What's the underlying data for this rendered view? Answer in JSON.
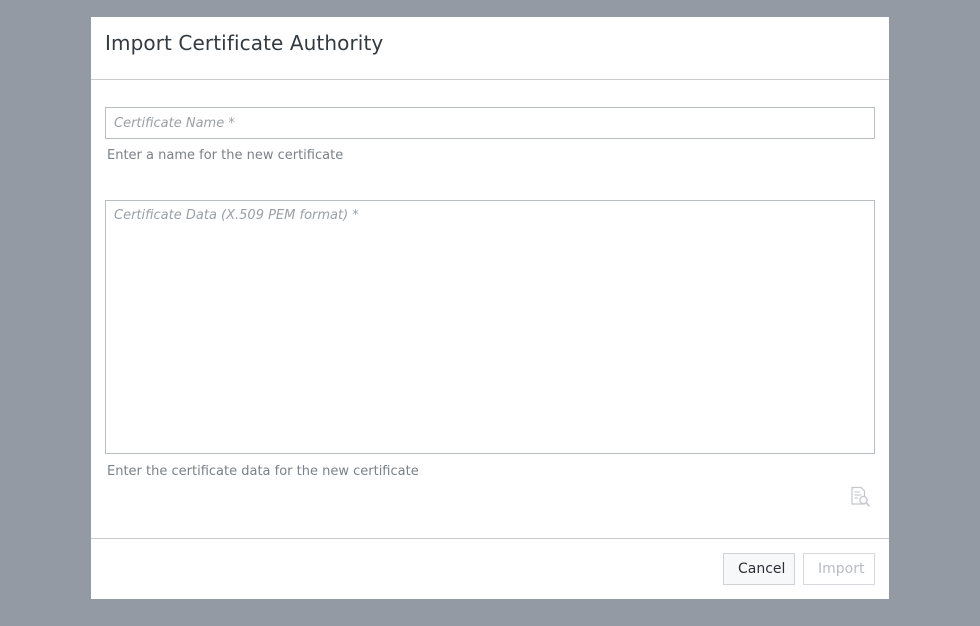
{
  "dialog": {
    "title": "Import Certificate Authority",
    "certificate_name": {
      "value": "",
      "placeholder": "Certificate Name *",
      "help": "Enter a name for the new certificate"
    },
    "certificate_data": {
      "value": "",
      "placeholder": "Certificate Data (X.509 PEM format) *",
      "help": "Enter the certificate data for the new certificate"
    },
    "file_icon": "file-search-icon",
    "buttons": {
      "cancel": "Cancel",
      "import": "Import"
    }
  },
  "colors": {
    "overlay": "#949aa3",
    "dialog_bg": "#ffffff",
    "title_text": "#333a40",
    "help_text": "#7b8188",
    "placeholder_text": "#9aa0a6",
    "border": "#b9bec3",
    "disabled_text": "#b8bcc1"
  }
}
